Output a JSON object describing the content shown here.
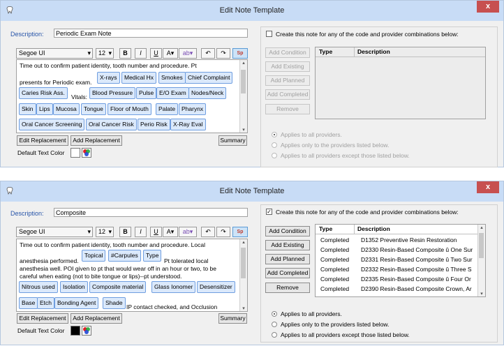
{
  "windows": [
    {
      "title": "Edit Note Template",
      "close_label": "x",
      "description_label": "Description:",
      "description_value": "Periodic Exam Note",
      "font_name": "Segoe UI",
      "font_size": "12",
      "toolbar": {
        "bold": "B",
        "italic": "I",
        "underline": "U",
        "font_color": "A",
        "highlight": "ab",
        "undo": "↶",
        "redo": "↷",
        "spell": "Sp"
      },
      "editor_lines": [
        "Time out to confirm patient identity, tooth number and procedure.  Pt",
        "presents for Periodic exam.",
        "Vitals:"
      ],
      "chips": [
        "X-rays",
        "Medical Hx",
        "Smokes",
        "Chief Complaint",
        "Caries Risk Ass.",
        "Blood Pressure",
        "Pulse",
        "E/O Exam",
        "Nodes/Neck",
        "Skin",
        "Lips",
        "Mucosa",
        "Tongue",
        "Floor of Mouth",
        "Palate",
        "Pharynx",
        "Oral Cancer Screening",
        "Oral Cancer Risk",
        "Perio Risk",
        "X-Ray Eval"
      ],
      "edit_replacement": "Edit Replacement",
      "add_replacement": "Add Replacement",
      "summary": "Summary",
      "default_text_color": "Default Text Color",
      "create_note_label": "Create this note for any of the code and provider combinations below:",
      "create_note_checked": false,
      "side_buttons": [
        "Add Condition",
        "Add Existing",
        "Add Planned",
        "Add Completed",
        "Remove"
      ],
      "grid_headers": [
        "Type",
        "Description"
      ],
      "grid_rows": [],
      "radios": [
        "Applies to all providers.",
        "Applies only to the providers listed below.",
        "Applies to all providers except those listed below."
      ],
      "radio_selected": 0,
      "enabled": false,
      "default_color": "#ffffff"
    },
    {
      "title": "Edit Note Template",
      "close_label": "x",
      "description_label": "Description:",
      "description_value": "Composite",
      "font_name": "Segoe UI",
      "font_size": "12",
      "toolbar": {
        "bold": "B",
        "italic": "I",
        "underline": "U",
        "font_color": "A",
        "highlight": "ab",
        "undo": "↶",
        "redo": "↷",
        "spell": "Sp"
      },
      "editor_lines": [
        "Time out to confirm patient identity, tooth number and procedure.  Local",
        "anesthesia performed.",
        "Pt tolerated local",
        "anesthesia well. POI given to pt that would wear off in an hour or two, to be",
        "careful when eating (not to bite tongue or lips)--pt understood.",
        "IP contact checked, and Occlusion"
      ],
      "chips": [
        "Topical",
        "#Carpules",
        "Type",
        "Nitrous used",
        "Isolation",
        "Composite material",
        "Glass Ionomer",
        "Desensitizer",
        "Base",
        "Etch",
        "Bonding Agent",
        "Shade"
      ],
      "edit_replacement": "Edit Replacement",
      "add_replacement": "Add Replacement",
      "summary": "Summary",
      "default_text_color": "Default Text Color",
      "create_note_label": "Create this note for any of the code and provider combinations below:",
      "create_note_checked": true,
      "side_buttons": [
        "Add Condition",
        "Add Existing",
        "Add Planned",
        "Add Completed",
        "Remove"
      ],
      "grid_headers": [
        "Type",
        "Description"
      ],
      "grid_rows": [
        {
          "type": "Completed",
          "description": "D1352 Preventive Resin Restoration"
        },
        {
          "type": "Completed",
          "description": "D2330 Resin-Based Composite û One Sur"
        },
        {
          "type": "Completed",
          "description": "D2331 Resin-Based Composite û Two Sur"
        },
        {
          "type": "Completed",
          "description": "D2332 Resin-Based Composite û Three S"
        },
        {
          "type": "Completed",
          "description": "D2335 Resin-Based Composite û Four Or"
        },
        {
          "type": "Completed",
          "description": "D2390 Resin-Based Composite Crown, Ar"
        }
      ],
      "radios": [
        "Applies to all providers.",
        "Applies only to the providers listed below.",
        "Applies to all providers except those listed below."
      ],
      "radio_selected": 0,
      "enabled": true,
      "default_color": "#000000"
    }
  ]
}
